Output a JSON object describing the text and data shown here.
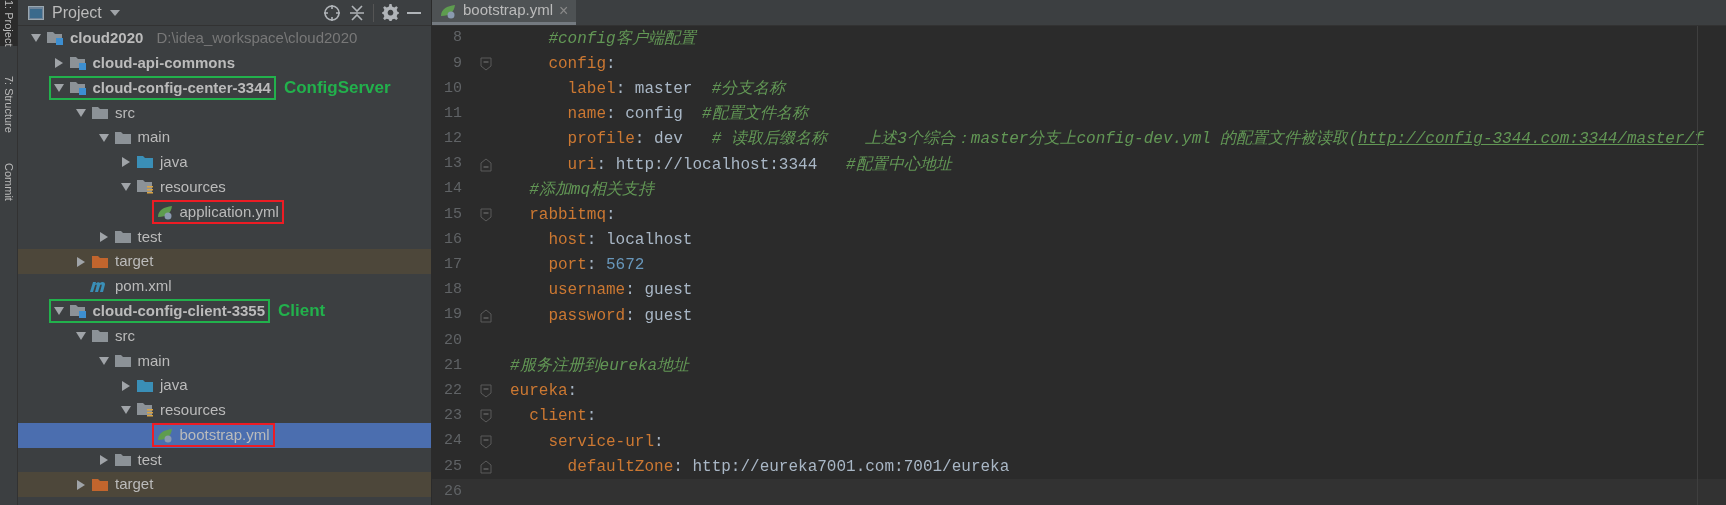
{
  "tool_strip": [
    {
      "label": "1: Project",
      "selected": true
    },
    {
      "label": "7: Structure",
      "selected": false
    },
    {
      "label": "Commit",
      "selected": false
    }
  ],
  "project_panel": {
    "title": "Project",
    "tree": [
      {
        "label": "cloud2020",
        "path": "D:\\idea_workspace\\cloud2020",
        "kind": "module",
        "expanded": true,
        "selected": false,
        "children": [
          {
            "label": "cloud-api-commons",
            "kind": "module",
            "expanded": false,
            "selected": false
          },
          {
            "label": "cloud-config-center-3344",
            "kind": "module",
            "expanded": true,
            "selected": false,
            "color": "#22b14c",
            "note": "ConfigServer",
            "children": [
              {
                "label": "src",
                "kind": "folder",
                "expanded": true,
                "selected": false,
                "children": [
                  {
                    "label": "main",
                    "kind": "folder",
                    "expanded": true,
                    "selected": false,
                    "children": [
                      {
                        "label": "java",
                        "kind": "source",
                        "expanded": false,
                        "selected": false
                      },
                      {
                        "label": "resources",
                        "kind": "resources",
                        "expanded": true,
                        "selected": false,
                        "children": [
                          {
                            "label": "application.yml",
                            "kind": "yml",
                            "selected": false,
                            "color": "#ed1c24"
                          }
                        ]
                      }
                    ]
                  },
                  {
                    "label": "test",
                    "kind": "folder",
                    "expanded": false,
                    "selected": false
                  }
                ]
              },
              {
                "label": "target",
                "kind": "excluded",
                "expanded": false,
                "selected": false
              },
              {
                "label": "pom.xml",
                "kind": "maven",
                "selected": false
              }
            ]
          },
          {
            "label": "cloud-config-client-3355",
            "kind": "module",
            "expanded": true,
            "selected": false,
            "color": "#22b14c",
            "note": "Client",
            "children": [
              {
                "label": "src",
                "kind": "folder",
                "expanded": true,
                "selected": false,
                "children": [
                  {
                    "label": "main",
                    "kind": "folder",
                    "expanded": true,
                    "selected": false,
                    "children": [
                      {
                        "label": "java",
                        "kind": "source",
                        "expanded": false,
                        "selected": false
                      },
                      {
                        "label": "resources",
                        "kind": "resources",
                        "expanded": true,
                        "selected": false,
                        "children": [
                          {
                            "label": "bootstrap.yml",
                            "kind": "yml",
                            "selected": true,
                            "color": "#ed1c24"
                          }
                        ]
                      }
                    ]
                  },
                  {
                    "label": "test",
                    "kind": "folder",
                    "expanded": false,
                    "selected": false
                  }
                ]
              },
              {
                "label": "target",
                "kind": "excluded",
                "expanded": false,
                "selected": false
              }
            ]
          }
        ]
      }
    ]
  },
  "editor": {
    "tabs": [
      {
        "label": "bootstrap.yml",
        "close": "×",
        "selected": true
      }
    ],
    "lines": [
      {
        "number": "8",
        "tokens": [
          {
            "kind": "comment",
            "text": "    #config客户端配置"
          }
        ]
      },
      {
        "number": "9",
        "fold_start": true,
        "tokens": [
          {
            "kind": "key",
            "text": "    config"
          },
          {
            "kind": "punct",
            "text": ":"
          }
        ]
      },
      {
        "number": "10",
        "tokens": [
          {
            "kind": "key",
            "text": "      label"
          },
          {
            "kind": "punct",
            "text": ": "
          },
          {
            "kind": "value",
            "text": "master  "
          },
          {
            "kind": "comment",
            "text": "#分支名称"
          }
        ]
      },
      {
        "number": "11",
        "tokens": [
          {
            "kind": "key",
            "text": "      name"
          },
          {
            "kind": "punct",
            "text": ": "
          },
          {
            "kind": "value",
            "text": "config  "
          },
          {
            "kind": "comment",
            "text": "#配置文件名称"
          }
        ]
      },
      {
        "number": "12",
        "tokens": [
          {
            "kind": "key",
            "text": "      profile"
          },
          {
            "kind": "punct",
            "text": ": "
          },
          {
            "kind": "value",
            "text": "dev   "
          },
          {
            "kind": "comment",
            "text": "# 读取后缀名称    上述3个综合：master分支上config-dev.yml 的配置文件被读取("
          },
          {
            "kind": "link",
            "text": "http://config-3344.com:3344/master/f"
          }
        ]
      },
      {
        "number": "13",
        "fold_end": true,
        "tokens": [
          {
            "kind": "key",
            "text": "      uri"
          },
          {
            "kind": "punct",
            "text": ": "
          },
          {
            "kind": "value",
            "text": "http://localhost:3344   "
          },
          {
            "kind": "comment",
            "text": "#配置中心地址"
          }
        ]
      },
      {
        "number": "14",
        "tokens": [
          {
            "kind": "comment",
            "text": "  #添加mq相关支持"
          }
        ]
      },
      {
        "number": "15",
        "fold_start": true,
        "tokens": [
          {
            "kind": "key",
            "text": "  rabbitmq"
          },
          {
            "kind": "punct",
            "text": ":"
          }
        ]
      },
      {
        "number": "16",
        "tokens": [
          {
            "kind": "key",
            "text": "    host"
          },
          {
            "kind": "punct",
            "text": ": "
          },
          {
            "kind": "value",
            "text": "localhost"
          }
        ]
      },
      {
        "number": "17",
        "tokens": [
          {
            "kind": "key",
            "text": "    port"
          },
          {
            "kind": "punct",
            "text": ": "
          },
          {
            "kind": "number",
            "text": "5672"
          }
        ]
      },
      {
        "number": "18",
        "tokens": [
          {
            "kind": "key",
            "text": "    username"
          },
          {
            "kind": "punct",
            "text": ": "
          },
          {
            "kind": "value",
            "text": "guest"
          }
        ]
      },
      {
        "number": "19",
        "fold_end": true,
        "tokens": [
          {
            "kind": "key",
            "text": "    password"
          },
          {
            "kind": "punct",
            "text": ": "
          },
          {
            "kind": "value",
            "text": "guest"
          }
        ]
      },
      {
        "number": "20"
      },
      {
        "number": "21",
        "tokens": [
          {
            "kind": "comment",
            "text": "#服务注册到eureka地址"
          }
        ]
      },
      {
        "number": "22",
        "fold_start": true,
        "tokens": [
          {
            "kind": "key",
            "text": "eureka"
          },
          {
            "kind": "punct",
            "text": ":"
          }
        ]
      },
      {
        "number": "23",
        "fold_start": true,
        "tokens": [
          {
            "kind": "key",
            "text": "  client"
          },
          {
            "kind": "punct",
            "text": ":"
          }
        ]
      },
      {
        "number": "24",
        "fold_start": true,
        "tokens": [
          {
            "kind": "key",
            "text": "    service-url"
          },
          {
            "kind": "punct",
            "text": ":"
          }
        ]
      },
      {
        "number": "25",
        "fold_end": true,
        "tokens": [
          {
            "kind": "key",
            "text": "      defaultZone"
          },
          {
            "kind": "punct",
            "text": ": "
          },
          {
            "kind": "value",
            "text": "http://eureka7001.com:7001/eureka"
          }
        ]
      },
      {
        "number": "26",
        "current": true
      }
    ]
  }
}
